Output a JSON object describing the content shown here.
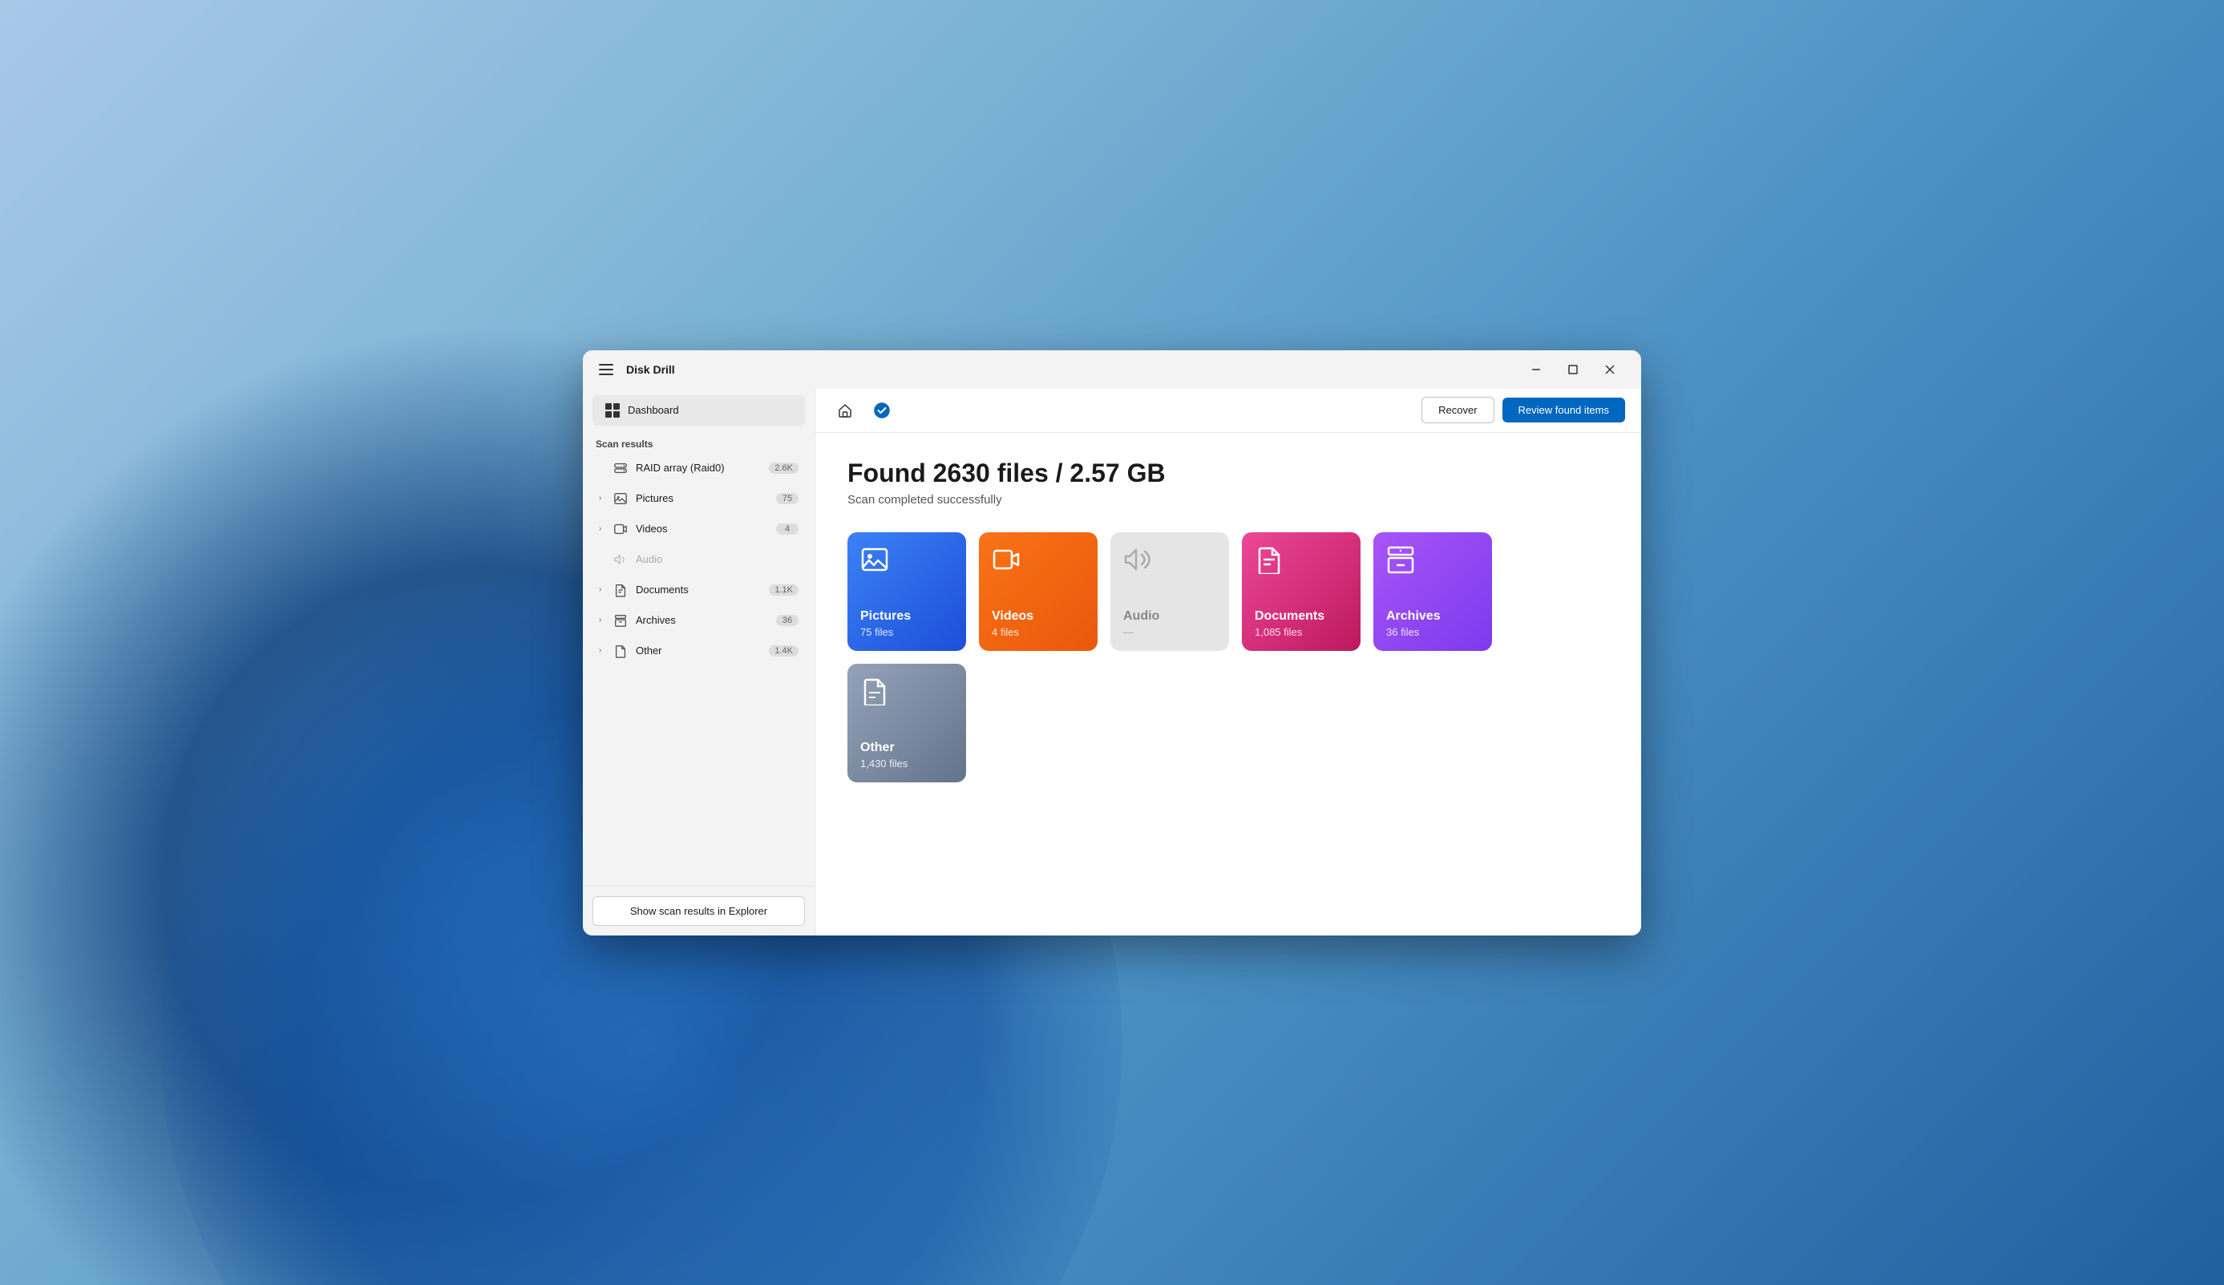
{
  "app": {
    "title": "Disk Drill",
    "window_controls": {
      "minimize": "—",
      "maximize": "□",
      "close": "✕"
    }
  },
  "sidebar": {
    "dashboard_label": "Dashboard",
    "section_label": "Scan results",
    "items": [
      {
        "id": "raid",
        "label": "RAID array (Raid0)",
        "count": "2.6K",
        "has_chevron": false,
        "icon": "raid-icon"
      },
      {
        "id": "pictures",
        "label": "Pictures",
        "count": "75",
        "has_chevron": true,
        "icon": "pictures-icon"
      },
      {
        "id": "videos",
        "label": "Videos",
        "count": "4",
        "has_chevron": true,
        "icon": "videos-icon"
      },
      {
        "id": "audio",
        "label": "Audio",
        "count": "",
        "has_chevron": false,
        "icon": "audio-icon",
        "disabled": true
      },
      {
        "id": "documents",
        "label": "Documents",
        "count": "1.1K",
        "has_chevron": true,
        "icon": "documents-icon"
      },
      {
        "id": "archives",
        "label": "Archives",
        "count": "36",
        "has_chevron": true,
        "icon": "archives-icon"
      },
      {
        "id": "other",
        "label": "Other",
        "count": "1.4K",
        "has_chevron": true,
        "icon": "other-icon"
      }
    ],
    "footer_button": "Show scan results in Explorer"
  },
  "topnav": {
    "recover_label": "Recover",
    "review_label": "Review found items"
  },
  "content": {
    "found_title": "Found 2630 files / 2.57 GB",
    "scan_status": "Scan completed successfully",
    "categories": [
      {
        "id": "pictures",
        "name": "Pictures",
        "count": "75 files",
        "color_class": "card-pictures",
        "icon": "picture"
      },
      {
        "id": "videos",
        "name": "Videos",
        "count": "4 files",
        "color_class": "card-videos",
        "icon": "video"
      },
      {
        "id": "audio",
        "name": "Audio",
        "count": "—",
        "color_class": "card-audio",
        "icon": "audio"
      },
      {
        "id": "documents",
        "name": "Documents",
        "count": "1,085 files",
        "color_class": "card-documents",
        "icon": "document"
      },
      {
        "id": "archives",
        "name": "Archives",
        "count": "36 files",
        "color_class": "card-archives",
        "icon": "archive"
      },
      {
        "id": "other",
        "name": "Other",
        "count": "1,430 files",
        "color_class": "card-other",
        "icon": "other"
      }
    ]
  }
}
